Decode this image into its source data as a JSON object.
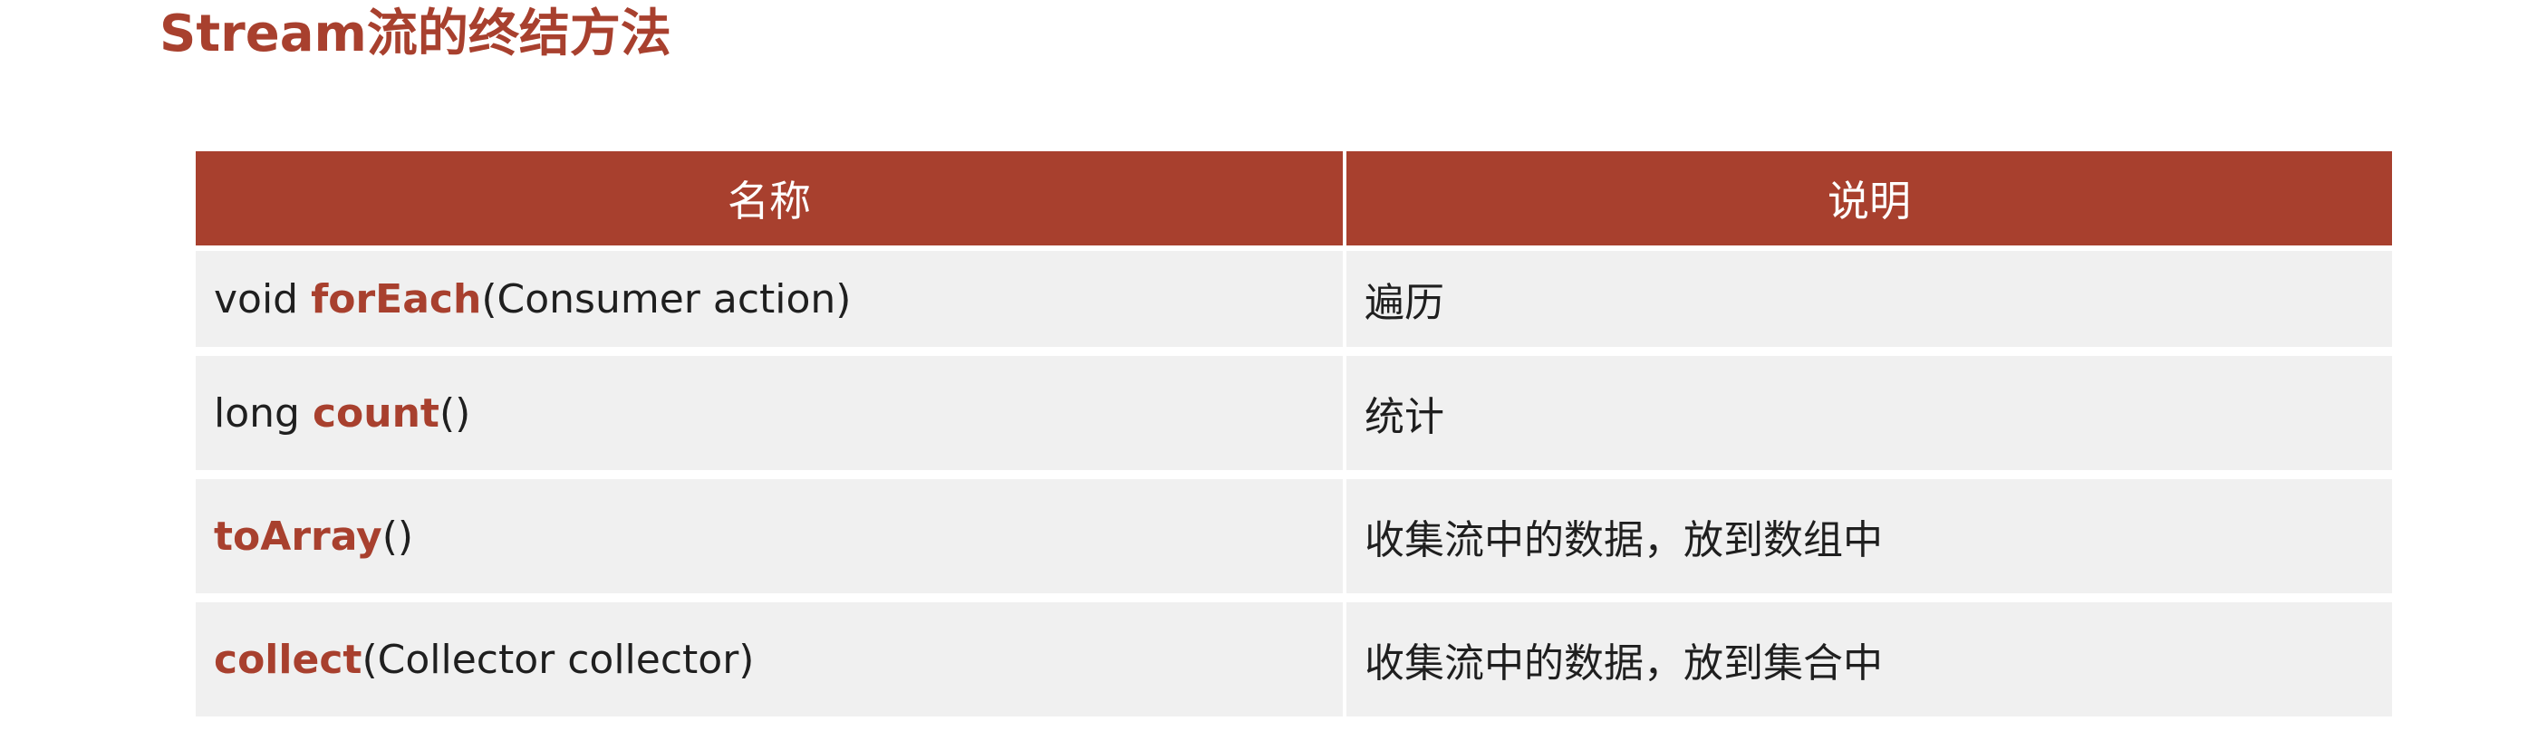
{
  "page": {
    "title": "Stream流的终结方法"
  },
  "table": {
    "headers": {
      "name": "名称",
      "description": "说明"
    },
    "rows": [
      {
        "prefix": "void ",
        "method": "forEach",
        "params": "(Consumer action)",
        "description": "遍历"
      },
      {
        "prefix": "long ",
        "method": "count",
        "params": "()",
        "description": "统计"
      },
      {
        "prefix": "",
        "method": "toArray",
        "params": "()",
        "description": "收集流中的数据，放到数组中"
      },
      {
        "prefix": "",
        "method": "collect",
        "params": "(Collector collector)",
        "description": "收集流中的数据，放到集合中"
      }
    ]
  },
  "colors": {
    "accent": "#a8402e",
    "row_background": "#f0f0f0",
    "header_text": "#ffffff"
  }
}
